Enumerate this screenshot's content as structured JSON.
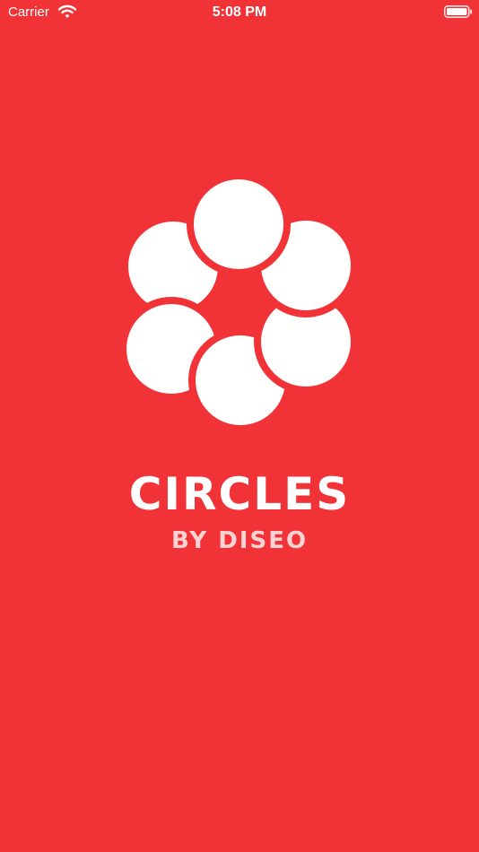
{
  "colors": {
    "background": "#f13337",
    "foreground": "#ffffff",
    "subtitle": "#ffd3d3"
  },
  "status_bar": {
    "carrier": "Carrier",
    "time": "5:08 PM",
    "icons": [
      "wifi-icon",
      "battery-icon"
    ]
  },
  "splash": {
    "logo_icon": "circles-flower-logo",
    "title": "CIRCLES",
    "subtitle": "BY DISEO"
  }
}
